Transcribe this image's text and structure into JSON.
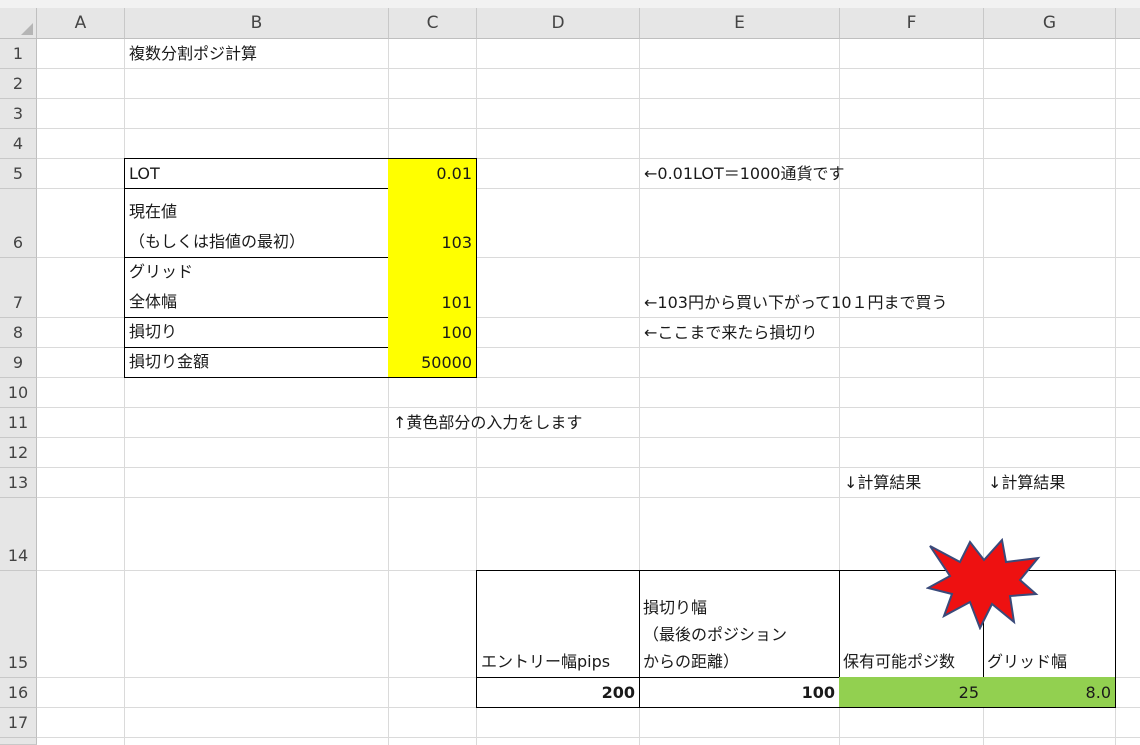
{
  "columns": [
    "A",
    "B",
    "C",
    "D",
    "E",
    "F",
    "G"
  ],
  "rows": [
    "1",
    "2",
    "3",
    "4",
    "5",
    "6",
    "7",
    "8",
    "9",
    "10",
    "11",
    "12",
    "13",
    "14",
    "15",
    "16",
    "17"
  ],
  "cells": {
    "B1": "複数分割ポジ計算",
    "B5": "LOT",
    "C5": "0.01",
    "E5": "←0.01LOT＝1000通貨です",
    "B6_line1": "現在値",
    "B6_line2": "（もしくは指値の最初）",
    "C6": "103",
    "B7_line1": "グリッド",
    "B7_line2": "全体幅",
    "C7": "101",
    "E7": "←103円から買い下がって10１円まで買う",
    "B8": "損切り",
    "C8": "100",
    "E8": "←ここまで来たら損切り",
    "B9": "損切り金額",
    "C9": "50000",
    "C11": "↑黄色部分の入力をします",
    "F13": "↓計算結果",
    "G13": "↓計算結果",
    "D15": "エントリー幅pips",
    "E15_line1": "損切り幅",
    "E15_line2": "（最後のポジション",
    "E15_line3": "からの距離）",
    "F15": "保有可能ポジ数",
    "G15": "グリッド幅",
    "D16": "200",
    "E16": "100",
    "F16": "25",
    "G16": "8.0"
  },
  "colors": {
    "input_fill": "#ffff00",
    "result_fill": "#92d050",
    "starburst_fill": "#ee1111",
    "starburst_stroke": "#3a4a7a",
    "header_bg": "#e6e6e6",
    "gridline": "#dadada"
  },
  "decorations": {
    "starburst": "explosion-shape"
  }
}
